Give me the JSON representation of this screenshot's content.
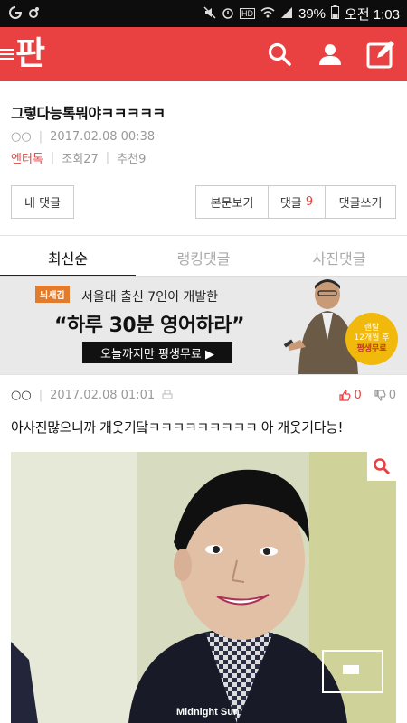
{
  "status": {
    "battery": "39%",
    "time": "오전 1:03",
    "net": "HD"
  },
  "app": {
    "logo": "판"
  },
  "post": {
    "title": "그렇다능톡뭐야ㅋㅋㅋㅋㅋ",
    "author": "○○",
    "datetime": "2017.02.08 00:38",
    "category": "엔터톡",
    "views_label": "조회",
    "views": "27",
    "recommend_label": "추천",
    "recommend": "9"
  },
  "buttons": {
    "my_comments": "내 댓글",
    "view_post": "본문보기",
    "comments_label": "댓글",
    "comments_count": "9",
    "write_comment": "댓글쓰기"
  },
  "tabs": {
    "latest": "최신순",
    "ranking": "랭킹댓글",
    "photo": "사진댓글"
  },
  "ad": {
    "brand": "뇌새김",
    "line1": "서울대 출신 7인이 개발한",
    "line2": "“하루 30분 영어하라”",
    "cta": "오늘까지만 평생무료 ▶",
    "badge_top": "랜탈",
    "badge_mid": "12개월 후",
    "badge_bottom": "평생무료"
  },
  "comment": {
    "author": "○○",
    "datetime": "2017.02.08 01:01",
    "likes": "0",
    "dislikes": "0",
    "text": "아사진많으니까 개웃기닼ㅋㅋㅋㅋㅋㅋㅋㅋㅋ 아 개웃기다능!",
    "watermark": "Midnight Sun"
  },
  "colors": {
    "brand": "#e94141",
    "status_bar": "#0d0d0d"
  }
}
